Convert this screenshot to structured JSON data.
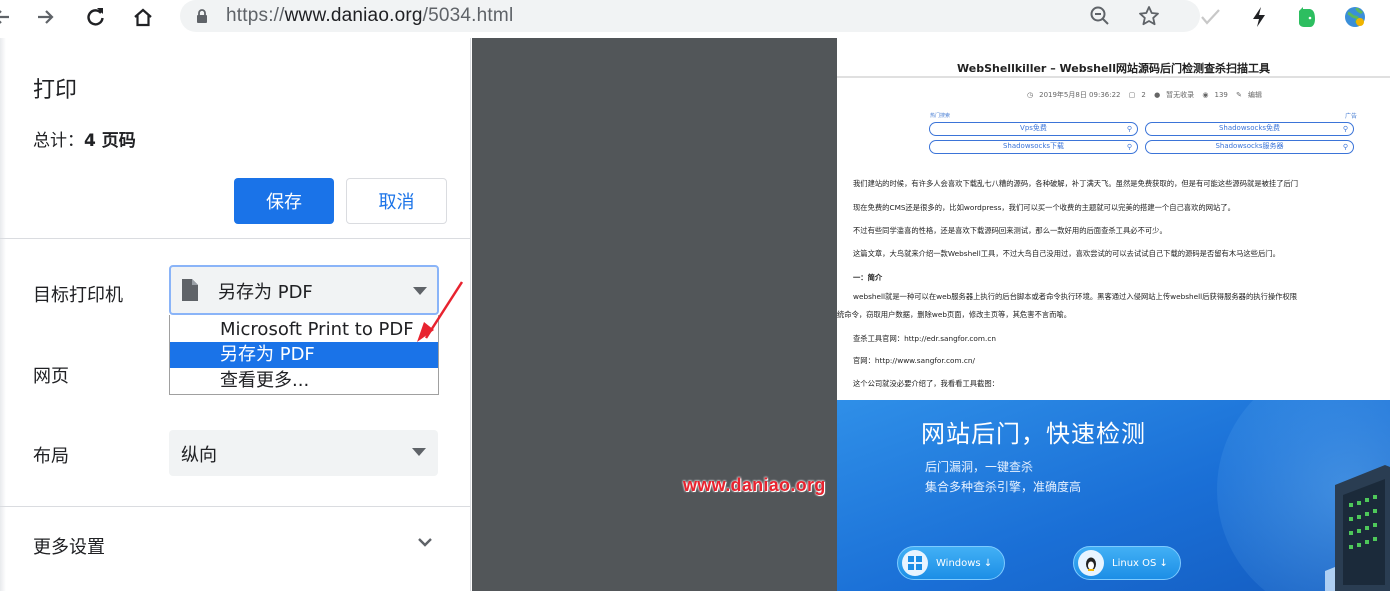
{
  "browser": {
    "url_scheme": "https://",
    "url_host": "www.daniao.org",
    "url_path": "/5034.html"
  },
  "print": {
    "title": "打印",
    "total_label": "总计：",
    "total_pages": "4 页码",
    "save_label": "保存",
    "cancel_label": "取消",
    "destination_label": "目标打印机",
    "destination_value": "另存为 PDF",
    "destination_options": [
      "Microsoft Print to PDF",
      "另存为 PDF",
      "查看更多..."
    ],
    "pages_label": "网页",
    "layout_label": "布局",
    "layout_value": "纵向",
    "more_settings_label": "更多设置"
  },
  "preview": {
    "article_title": "WebShellkiller – Webshell网站源码后门检测查杀扫描工具",
    "meta": {
      "date": "2019年5月8日  09:36:22",
      "comments": "2",
      "comment_status": "暂无收录",
      "views": "139",
      "edit": "编辑"
    },
    "search_left_label": "热门搜索",
    "search_right_label": "广告",
    "search_pills": [
      "Vps免费",
      "Shadowsocks免费",
      "Shadowsocks下载",
      "Shadowsocks服务器"
    ],
    "paragraphs": [
      "我们建站的时候，有许多人会喜欢下载乱七八糟的源码，各种破解，补丁满天飞。虽然是免费获取的，但是有可能这些源码就是被挂了后门",
      "现在免费的CMS还是很多的，比如wordpress，我们可以买一个收费的主题就可以完美的搭建一个自己喜欢的网站了。",
      "不过有些同学滥喜的性格，还是喜欢下载源码回来测试，那么一款好用的后面查杀工具必不可少。",
      "这篇文章，大鸟就来介绍一款Webshell工具，不过大鸟自己没用过，喜欢尝试的可以去试试自己下载的源码是否留有木马这些后门。",
      "一：简介",
      "webshell就是一种可以在web服务器上执行的后台脚本或者命令执行环境。黑客通过入侵网站上传webshell后获得服务器的执行操作权限",
      "统命令，窃取用户数据，删除web页面，修改主页等，其危害不言而喻。",
      "查杀工具官网：http://edr.sangfor.com.cn",
      "官网：http://www.sangfor.com.cn/",
      "这个公司就没必要介绍了，我看看工具截图："
    ],
    "banner": {
      "heading": "网站后门，快速检测",
      "sub1": "后门漏洞，一键查杀",
      "sub2": "集合多种查杀引擎，准确度高",
      "windows_btn": "Windows ↓",
      "linux_btn": "Linux OS ↓"
    }
  },
  "watermark": "www.daniao.org",
  "colors": {
    "accent": "#1a73e8",
    "preview_bg": "#525659",
    "watermark": "#e8232f",
    "annotation_arrow": "#e8232f"
  }
}
